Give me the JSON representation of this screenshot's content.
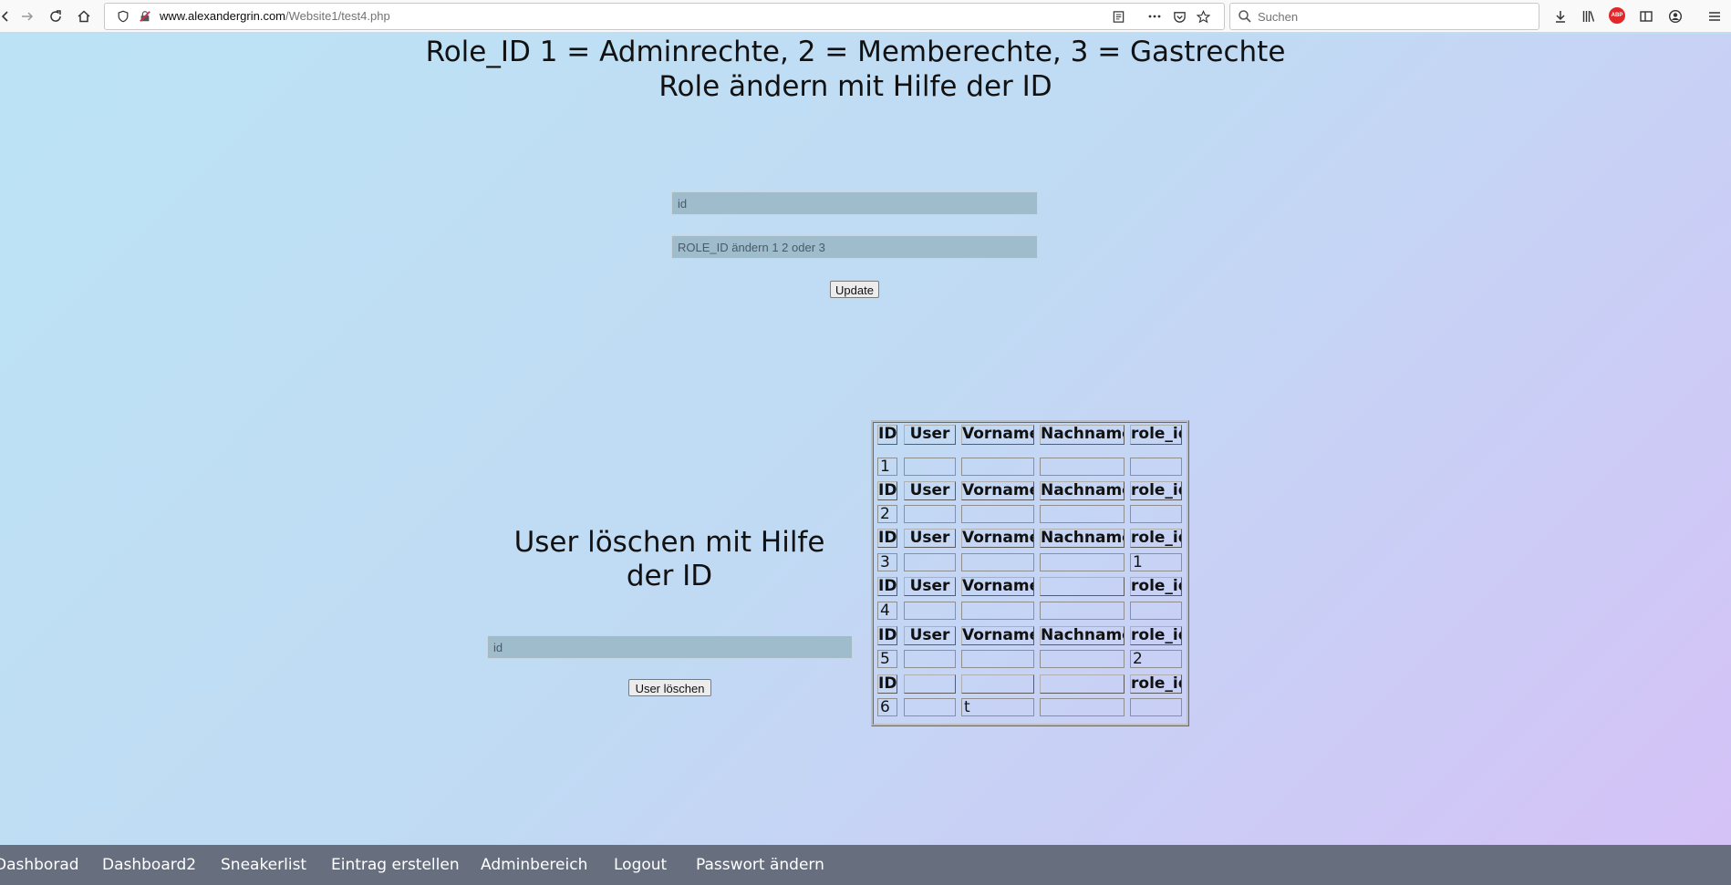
{
  "browser": {
    "url_domain": "www.alexandergrin.com",
    "url_path": "/Website1/test4.php",
    "search_placeholder": "Suchen",
    "abp_label": "ABP"
  },
  "headings": {
    "line1": "Role_ID 1 = Adminrechte, 2 = Memberechte, 3 = Gastrechte",
    "line2": "Role ändern mit Hilfe der ID"
  },
  "update_form": {
    "id_placeholder": "id",
    "role_placeholder": "ROLE_ID ändern 1 2 oder 3",
    "button_label": "Update"
  },
  "delete_form": {
    "heading": "User löschen mit Hilfe der ID",
    "id_placeholder": "id",
    "button_label": "User löschen"
  },
  "users_table": {
    "columns": [
      "ID",
      "User",
      "Vorname",
      "Nachname",
      "role_id"
    ],
    "rows": [
      {
        "header": [
          "ID",
          "User",
          "Vorname",
          "Nachname",
          "role_id"
        ],
        "values": [
          "1",
          "",
          "",
          "",
          ""
        ]
      },
      {
        "header": [
          "ID",
          "User",
          "Vorname",
          "Nachname",
          "role_id"
        ],
        "values": [
          "2",
          "",
          "",
          "",
          ""
        ]
      },
      {
        "header": [
          "ID",
          "User",
          "Vorname",
          "Nachname",
          "role_id"
        ],
        "values": [
          "3",
          "",
          "",
          "",
          "1"
        ]
      },
      {
        "header": [
          "ID",
          "User",
          "Vorname",
          "",
          "role_id"
        ],
        "values": [
          "4",
          "",
          "",
          "",
          ""
        ]
      },
      {
        "header": [
          "ID",
          "User",
          "Vorname",
          "Nachname",
          "role_id"
        ],
        "values": [
          "5",
          "",
          "",
          "",
          "2"
        ]
      },
      {
        "header": [
          "ID",
          "",
          "",
          "",
          "role_id"
        ],
        "values": [
          "6",
          "",
          "t",
          "",
          ""
        ]
      }
    ]
  },
  "bottom_nav": {
    "items": [
      "Dashborad",
      "Dashboard2",
      "Sneakerlist",
      "Eintrag erstellen",
      "Adminbereich",
      "Logout",
      "Passwort ändern"
    ]
  }
}
